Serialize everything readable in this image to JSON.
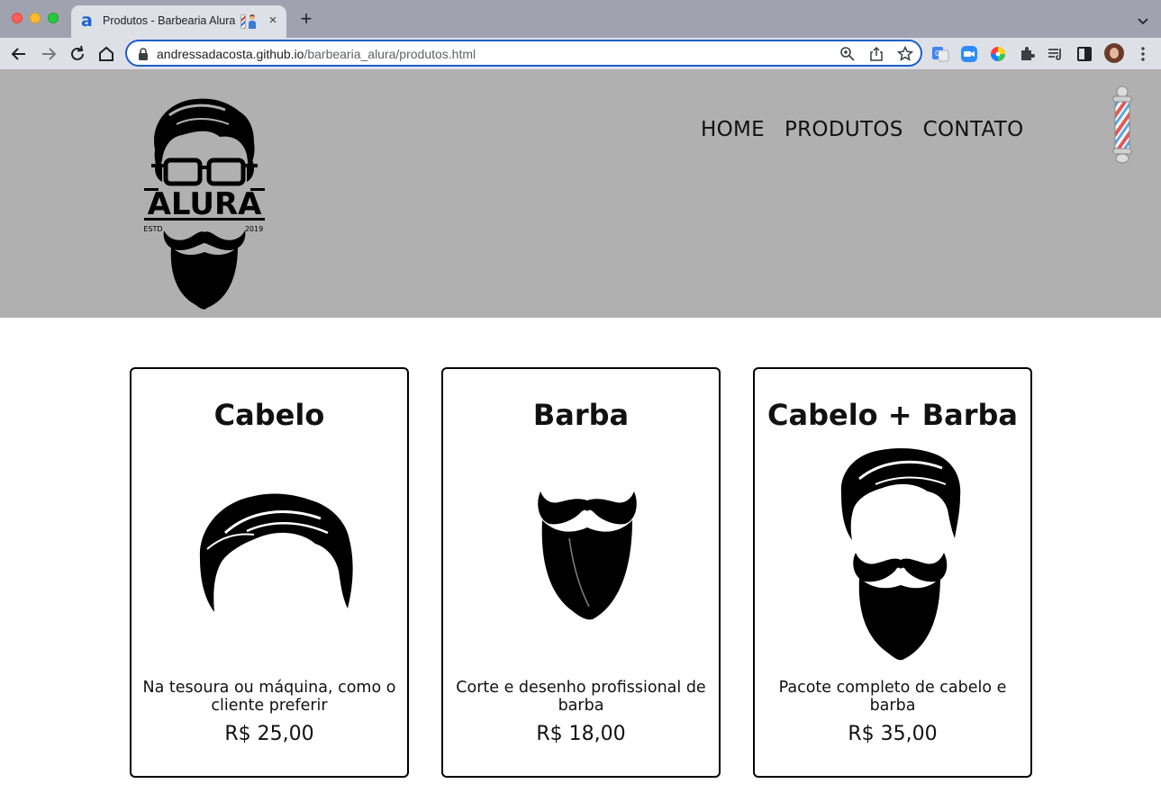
{
  "browser": {
    "tab_title": "Produtos - Barbearia Alura",
    "url_host": "andressadacosta.github.io",
    "url_path": "/barbearia_alura/produtos.html",
    "new_tab_label": "+",
    "tab_close_label": "×"
  },
  "header": {
    "logo_text": "ALURA",
    "logo_est": "ESTD",
    "logo_year": "2019",
    "nav": [
      {
        "label": "HOME"
      },
      {
        "label": "PRODUTOS"
      },
      {
        "label": "CONTATO"
      }
    ]
  },
  "products": [
    {
      "title": "Cabelo",
      "description": "Na tesoura ou máquina, como o cliente preferir",
      "price": "R$ 25,00",
      "icon": "hair-icon"
    },
    {
      "title": "Barba",
      "description": "Corte e desenho profissional de barba",
      "price": "R$ 18,00",
      "icon": "beard-icon"
    },
    {
      "title": "Cabelo + Barba",
      "description": "Pacote completo de cabelo e barba",
      "price": "R$ 35,00",
      "icon": "hair-and-beard-icon"
    }
  ],
  "colors": {
    "header_bg": "#b0b0b0",
    "card_border": "#000000",
    "omnibox_focus": "#1a5ec7"
  }
}
